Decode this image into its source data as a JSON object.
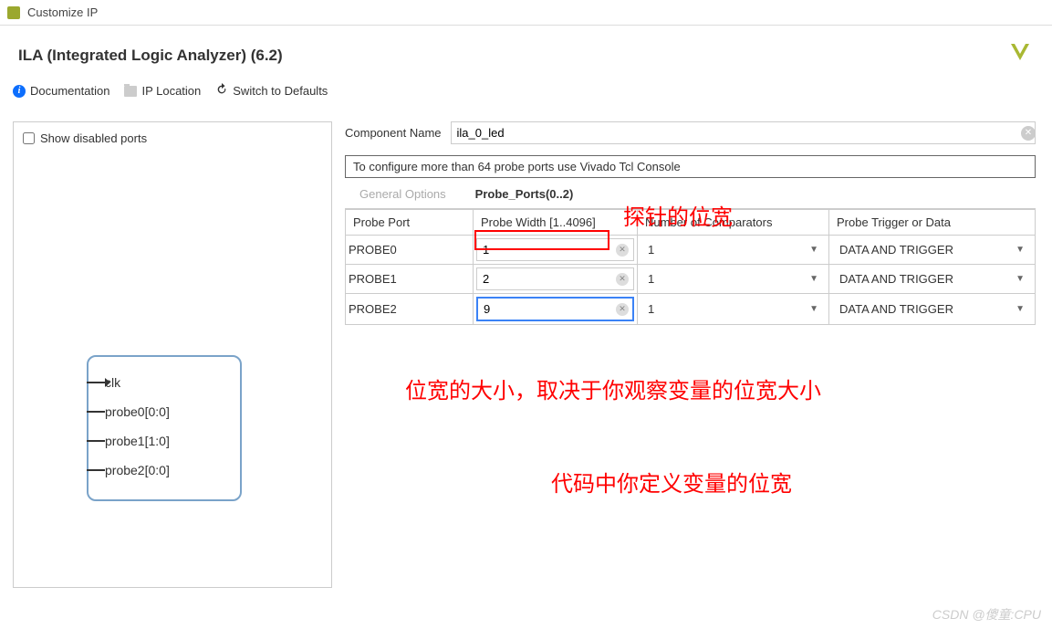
{
  "window": {
    "title": "Customize IP"
  },
  "header": {
    "ip_name": "ILA (Integrated Logic Analyzer) (6.2)"
  },
  "toolbar": {
    "doc": "Documentation",
    "ip_location": "IP Location",
    "switch": "Switch to Defaults"
  },
  "left": {
    "show_disabled": "Show disabled ports",
    "ports": [
      "clk",
      "probe0[0:0]",
      "probe1[1:0]",
      "probe2[0:0]"
    ]
  },
  "right": {
    "component_name_label": "Component Name",
    "component_name": "ila_0_led",
    "info_text": "To configure more than 64 probe ports use Vivado Tcl Console",
    "tabs": {
      "general": "General Options",
      "probe": "Probe_Ports(0..2)"
    },
    "table": {
      "headers": {
        "port": "Probe Port",
        "width": "Probe Width [1..4096]",
        "comparators": "Number of Comparators",
        "trigger": "Probe Trigger or Data"
      },
      "rows": [
        {
          "port": "PROBE0",
          "width": "1",
          "comparators": "1",
          "trigger": "DATA AND TRIGGER"
        },
        {
          "port": "PROBE1",
          "width": "2",
          "comparators": "1",
          "trigger": "DATA AND TRIGGER"
        },
        {
          "port": "PROBE2",
          "width": "9",
          "comparators": "1",
          "trigger": "DATA AND TRIGGER"
        }
      ]
    }
  },
  "annotations": {
    "a1": "探针的位宽",
    "a2": "位宽的大小，取决于你观察变量的位宽大小",
    "a3": "代码中你定义变量的位宽"
  },
  "watermark": "CSDN @傻童:CPU"
}
